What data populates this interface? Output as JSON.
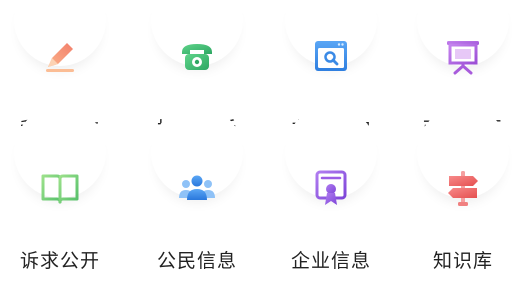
{
  "services": [
    {
      "label": "我要写信",
      "icon": "pencil-icon",
      "color": "#f59b7a"
    },
    {
      "label": "拨打电话",
      "icon": "telephone-icon",
      "color": "#4cc27c"
    },
    {
      "label": "办理查询",
      "icon": "browser-search-icon",
      "color": "#4a8fe8"
    },
    {
      "label": "政务公开",
      "icon": "presentation-board-icon",
      "color": "#b46be0"
    },
    {
      "label": "诉求公开",
      "icon": "open-book-icon",
      "color": "#7bd26d"
    },
    {
      "label": "公民信息",
      "icon": "people-group-icon",
      "color": "#3f8fe6"
    },
    {
      "label": "企业信息",
      "icon": "certificate-icon",
      "color": "#9b5de5"
    },
    {
      "label": "知识库",
      "icon": "signpost-icon",
      "color": "#f26d6d"
    }
  ]
}
